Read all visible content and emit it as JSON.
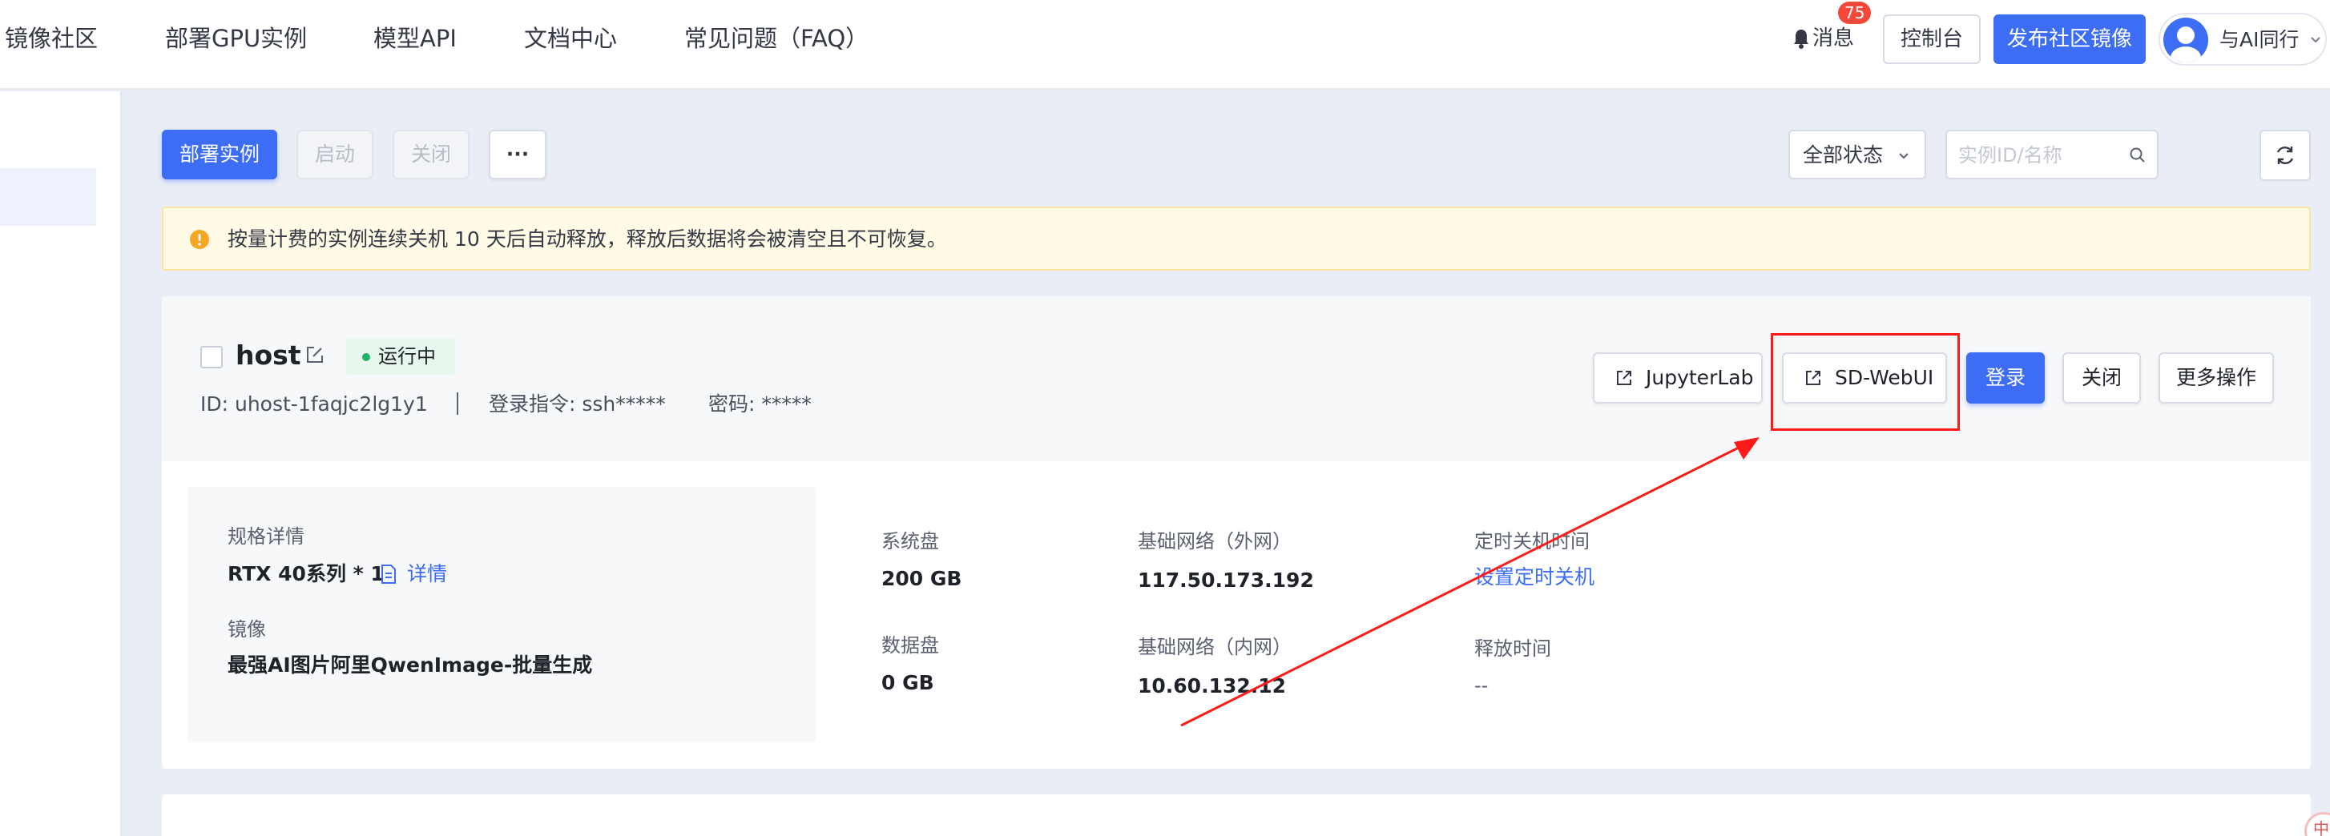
{
  "nav": {
    "items": [
      "镜像社区",
      "部署GPU实例",
      "模型API",
      "文档中心",
      "常见问题（FAQ）"
    ],
    "messages_label": "消息",
    "messages_count": "75",
    "console_label": "控制台",
    "publish_label": "发布社区镜像",
    "user_name": "与AI同行"
  },
  "toolbar": {
    "deploy_label": "部署实例",
    "start_label": "启动",
    "stop_label": "关闭",
    "more_label": "···",
    "status_filter": "全部状态",
    "search_placeholder": "实例ID/名称"
  },
  "notice": {
    "text": "按量计费的实例连续关机 10 天后自动释放，释放后数据将会被清空且不可恢复。"
  },
  "instance": {
    "name": "host",
    "status": "运行中",
    "id_text": "ID: uhost-1faqjc2lg1y1",
    "login_cmd": "登录指令: ssh*****",
    "password": "密码: *****",
    "actions": {
      "jupyter": "JupyterLab",
      "sdwebui": "SD-WebUI",
      "login": "登录",
      "close": "关闭",
      "more": "更多操作"
    },
    "spec": {
      "spec_label": "规格详情",
      "spec_value": "RTX 40系列 * 1",
      "detail_link": "详情",
      "image_label": "镜像",
      "image_value": "最强AI图片阿里QwenImage-批量生成"
    },
    "storage": {
      "system_disk_label": "系统盘",
      "system_disk_value": "200 GB",
      "data_disk_label": "数据盘",
      "data_disk_value": "0 GB"
    },
    "network": {
      "public_label": "基础网络（外网）",
      "public_ip": "117.50.173.192",
      "private_label": "基础网络（内网）",
      "private_ip": "10.60.132.12"
    },
    "schedule": {
      "shutdown_label": "定时关机时间",
      "shutdown_link": "设置定时关机",
      "release_label": "释放时间",
      "release_value": "--"
    }
  },
  "corner_badge": "中",
  "colors": {
    "primary": "#3d6df5",
    "annotation_red": "#ff1a1a",
    "running_green": "#1fb265",
    "notice_bg": "#fffbe6",
    "badge_red": "#f5483b"
  }
}
